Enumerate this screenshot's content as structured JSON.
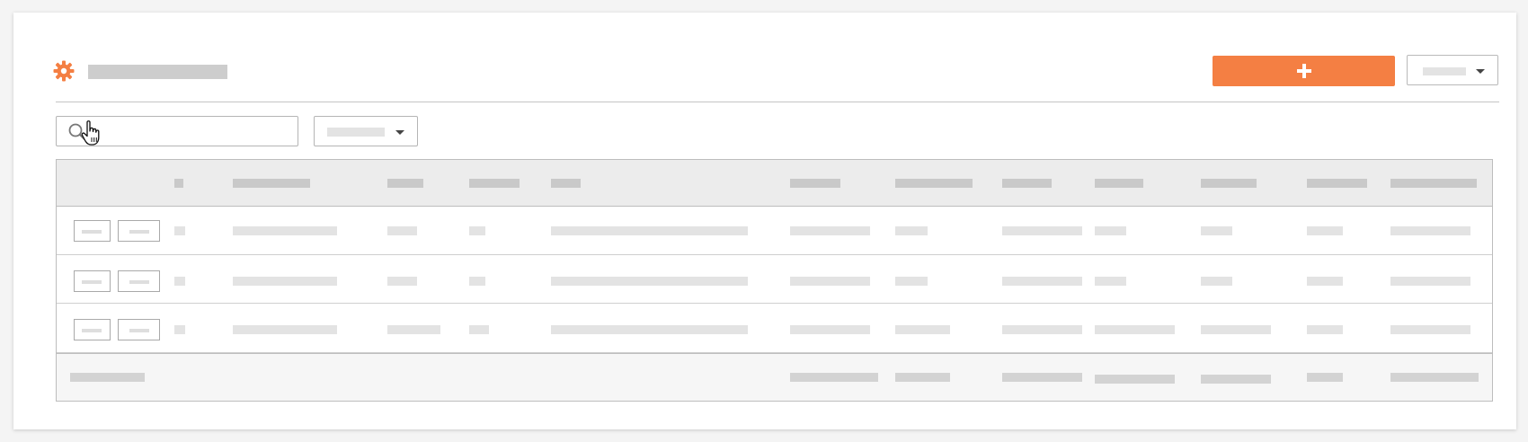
{
  "header": {
    "icon": "gear-icon",
    "add_button_icon": "plus-icon",
    "accent": "#f47f43"
  },
  "toolbar": {
    "search_icon": "search-icon",
    "search_value": "",
    "filter_caret_icon": "caret-down-icon"
  },
  "table": {
    "row_count": 3,
    "has_header": true,
    "has_footer": true
  },
  "cursor": "hand-pointer-icon"
}
